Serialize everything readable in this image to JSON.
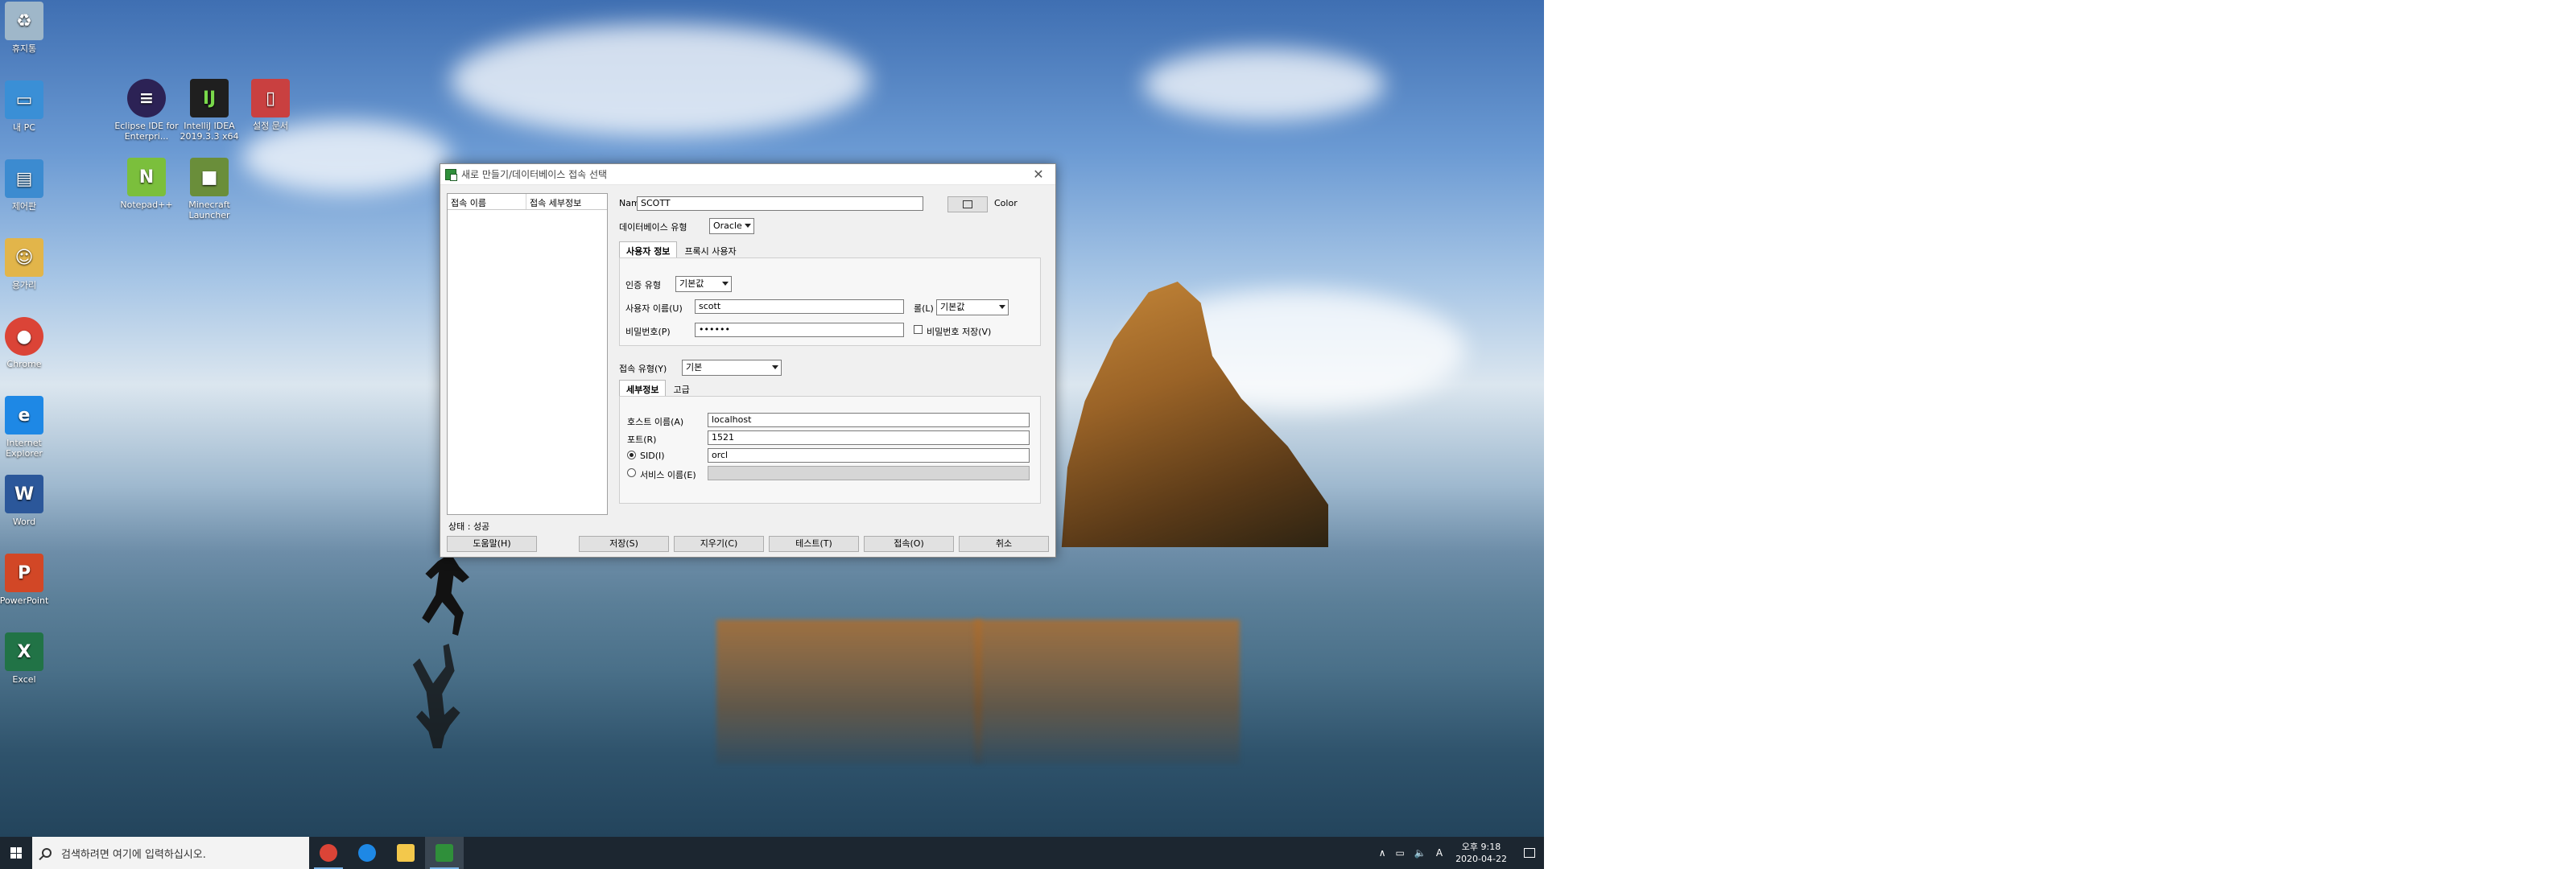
{
  "desktop": {
    "icons": [
      {
        "label": "휴지통",
        "icon": "recycle-bin-icon",
        "color": "#9fb7c9"
      },
      {
        "label": "내 PC",
        "icon": "this-pc-icon",
        "color": "#3a8fd6"
      },
      {
        "label": "제어판",
        "icon": "control-panel-icon",
        "color": "#3c8bd0"
      },
      {
        "label": "용가리",
        "icon": "user-folder-icon",
        "color": "#e2b54a"
      },
      {
        "label": "Chrome",
        "icon": "chrome-icon",
        "color": "#db4437"
      },
      {
        "label": "Internet Explorer",
        "icon": "internet-explorer-icon",
        "color": "#1e88e5"
      },
      {
        "label": "Word",
        "icon": "word-icon",
        "color": "#2b579a"
      },
      {
        "label": "PowerPoint",
        "icon": "powerpoint-icon",
        "color": "#d24726"
      },
      {
        "label": "Excel",
        "icon": "excel-icon",
        "color": "#217346"
      },
      {
        "label": "Eclipse IDE for Enterpri...",
        "icon": "eclipse-icon",
        "color": "#2c2255"
      },
      {
        "label": "IntelliJ IDEA 2019.3.3 x64",
        "icon": "intellij-icon",
        "color": "#1f1f1f"
      },
      {
        "label": "설정 문서",
        "icon": "document-icon",
        "color": "#c94040"
      },
      {
        "label": "Notepad++",
        "icon": "notepad-plus-icon",
        "color": "#7bbf3c"
      },
      {
        "label": "Minecraft Launcher",
        "icon": "minecraft-icon",
        "color": "#6a8e3a"
      }
    ]
  },
  "dialog": {
    "title": "새로 만들기/데이터베이스 접속 선택",
    "close_glyph": "✕",
    "list_headers": [
      "접속 이름",
      "접속 세부정보"
    ],
    "name_label": "Name",
    "name_value": "SCOTT",
    "color_label": "Color",
    "db_type_label": "데이터베이스 유형",
    "db_type_value": "Oracle",
    "user_tabs": [
      "사용자 정보",
      "프록시 사용자"
    ],
    "auth_type_label": "인증 유형",
    "auth_type_value": "기본값",
    "username_label": "사용자 이름(U)",
    "username_value": "scott",
    "role_label": "롤(L)",
    "role_value": "기본값",
    "password_label": "비밀번호(P)",
    "password_value": "••••••",
    "save_password_label": "비밀번호 저장(V)",
    "conn_type_label": "접속 유형(Y)",
    "conn_type_value": "기본",
    "detail_tabs": [
      "세부정보",
      "고급"
    ],
    "host_label": "호스트 이름(A)",
    "host_value": "localhost",
    "port_label": "포트(R)",
    "port_value": "1521",
    "sid_label": "SID(I)",
    "sid_value": "orcl",
    "service_label": "서비스 이름(E)",
    "status_text": "상태 : 성공",
    "buttons": {
      "help": "도움말(H)",
      "save": "저장(S)",
      "clear": "지우기(C)",
      "test": "테스트(T)",
      "connect": "접속(O)",
      "cancel": "취소"
    }
  },
  "taskbar": {
    "search_placeholder": "검색하려면 여기에 입력하십시오.",
    "apps": [
      {
        "icon": "chrome-icon",
        "color": "#db4437"
      },
      {
        "icon": "internet-explorer-icon",
        "color": "#1e88e5"
      },
      {
        "icon": "file-explorer-icon",
        "color": "#f3c84b"
      },
      {
        "icon": "sql-developer-icon",
        "color": "#2f8f3a"
      }
    ],
    "tray": {
      "chevron": "∧",
      "network": "▭",
      "volume": "🔈",
      "ime": "A",
      "time": "오후 9:18",
      "date": "2020-04-22"
    }
  }
}
